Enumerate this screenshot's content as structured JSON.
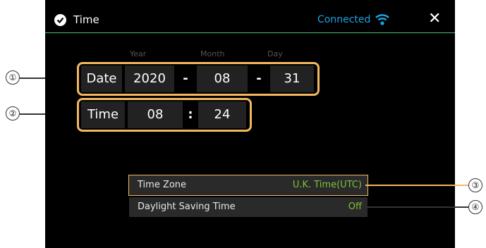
{
  "titlebar": {
    "title": "Time",
    "status": "Connected",
    "icons": {
      "clock": "clock-check-icon",
      "wifi": "wifi-icon",
      "close": "close-icon"
    },
    "close_label": "✕"
  },
  "date_time": {
    "labels": {
      "year": "Year",
      "month": "Month",
      "day": "Day"
    },
    "date_label": "Date",
    "year": "2020",
    "month": "08",
    "day": "31",
    "date_sep": "-",
    "time_label": "Time",
    "hour": "08",
    "time_sep": ":",
    "minute": "24"
  },
  "settings": [
    {
      "label": "Time Zone",
      "value": "U.K. Time(UTC)"
    },
    {
      "label": "Daylight Saving Time",
      "value": "Off"
    }
  ],
  "callouts": [
    "①",
    "②",
    "③",
    "④"
  ],
  "colors": {
    "accent_frame": "#f2b85e",
    "value_green": "#7ec13a",
    "status_blue": "#1aa3e0",
    "divider": "#3ec27a"
  }
}
